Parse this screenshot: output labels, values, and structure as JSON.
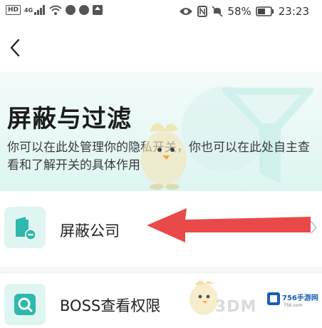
{
  "status_bar": {
    "left_indicators": {
      "hd": "HD",
      "network": "4G"
    },
    "battery_percent": "58%",
    "time": "23:23"
  },
  "page": {
    "title": "屏蔽与过滤",
    "description": "你可以在此处管理你的隐私开关，你也可以在此处自主查看和了解开关的具体作用"
  },
  "menu": {
    "items": [
      {
        "label": "屏蔽公司"
      },
      {
        "label": "BOSS查看权限"
      }
    ]
  },
  "watermark": {
    "site_name": "756手游网",
    "site_url": "756.com",
    "logo_text": "3DM"
  },
  "colors": {
    "accent": "#3cc1b5",
    "icon_bg": "#dff5f2",
    "annotation_arrow": "#e8393a"
  }
}
